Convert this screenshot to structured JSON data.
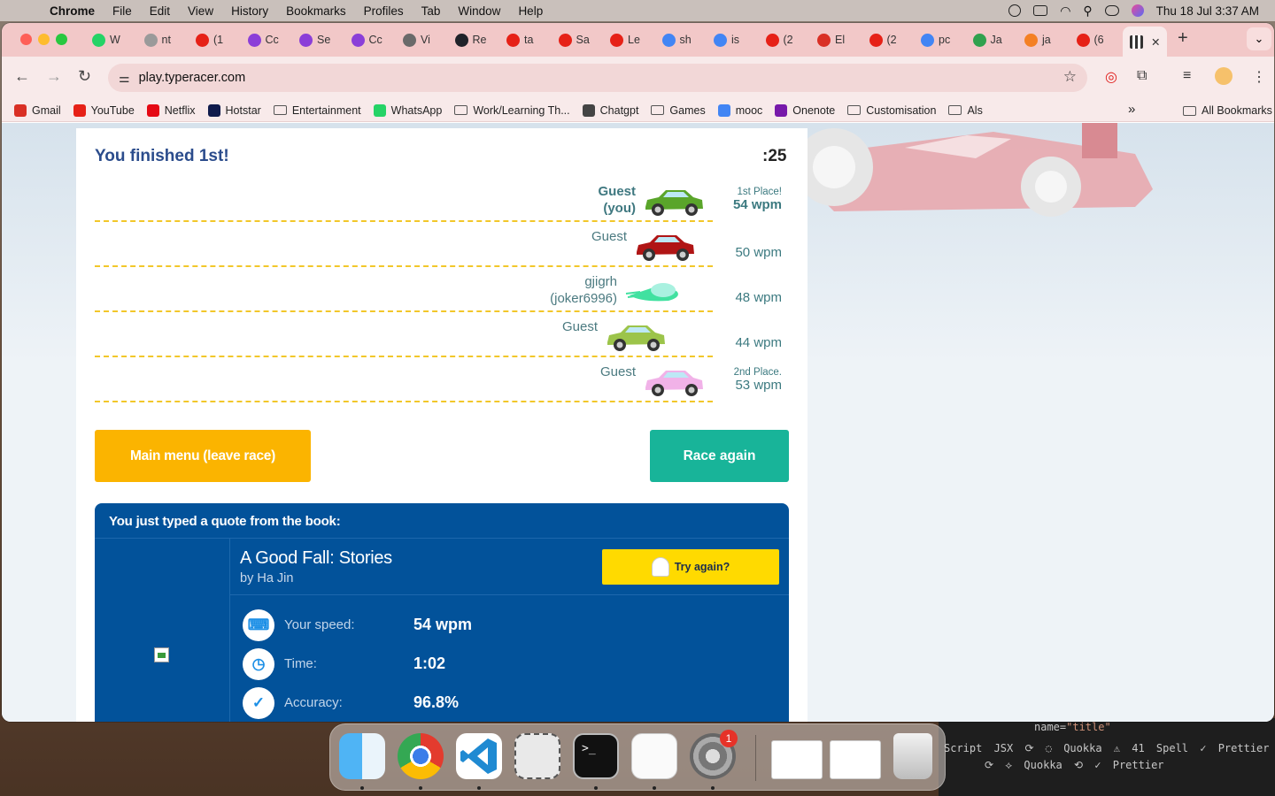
{
  "menubar": {
    "app": "Chrome",
    "items": [
      "File",
      "Edit",
      "View",
      "History",
      "Bookmarks",
      "Profiles",
      "Tab",
      "Window",
      "Help"
    ],
    "clock": "Thu 18 Jul  3:37 AM"
  },
  "tabs": [
    {
      "label": "W",
      "color": "#25d366"
    },
    {
      "label": "nt",
      "color": "#9a9a9a"
    },
    {
      "label": "(1",
      "color": "#e62117"
    },
    {
      "label": "Cc",
      "color": "#8b3fd8"
    },
    {
      "label": "Se",
      "color": "#8b3fd8"
    },
    {
      "label": "Cc",
      "color": "#8b3fd8"
    },
    {
      "label": "Vi",
      "color": "#6a6a6a"
    },
    {
      "label": "Re",
      "color": "#20232a"
    },
    {
      "label": "ta",
      "color": "#e62117"
    },
    {
      "label": "Sa",
      "color": "#e62117"
    },
    {
      "label": "Le",
      "color": "#e62117"
    },
    {
      "label": "sh",
      "color": "#4285f4"
    },
    {
      "label": "is",
      "color": "#4285f4"
    },
    {
      "label": "(2",
      "color": "#e62117"
    },
    {
      "label": "El",
      "color": "#d93025"
    },
    {
      "label": "(2",
      "color": "#e62117"
    },
    {
      "label": "pc",
      "color": "#4285f4"
    },
    {
      "label": "Ja",
      "color": "#30a14e"
    },
    {
      "label": "ja",
      "color": "#f48024"
    },
    {
      "label": "(6",
      "color": "#e62117"
    }
  ],
  "active_tab": {
    "close": "✕"
  },
  "address": {
    "url": "play.typeracer.com"
  },
  "bookmarks": [
    {
      "label": "Gmail",
      "type": "site",
      "color": "#d93025"
    },
    {
      "label": "YouTube",
      "type": "site",
      "color": "#e62117"
    },
    {
      "label": "Netflix",
      "type": "site",
      "color": "#e50914"
    },
    {
      "label": "Hotstar",
      "type": "site",
      "color": "#0f1b4c"
    },
    {
      "label": "Entertainment",
      "type": "folder"
    },
    {
      "label": "WhatsApp",
      "type": "site",
      "color": "#25d366"
    },
    {
      "label": "Work/Learning Th...",
      "type": "folder"
    },
    {
      "label": "Chatgpt",
      "type": "site",
      "color": "#444444"
    },
    {
      "label": "Games",
      "type": "folder"
    },
    {
      "label": "mooc",
      "type": "site",
      "color": "#4285f4"
    },
    {
      "label": "Onenote",
      "type": "site",
      "color": "#7719aa"
    },
    {
      "label": "Customisation",
      "type": "folder"
    },
    {
      "label": "Als",
      "type": "folder"
    }
  ],
  "bookmarks_more": "»",
  "all_bookmarks": "All Bookmarks",
  "race": {
    "heading": "You finished 1st!",
    "timer": ":25",
    "racers": [
      {
        "name_line1": "Guest",
        "name_line2": "(you)",
        "place": "1st Place!",
        "wpm": "54 wpm",
        "car_color": "#5aa52a",
        "you": true
      },
      {
        "name_line1": "Guest",
        "name_line2": "",
        "place": "",
        "wpm": "50 wpm",
        "car_color": "#b01515",
        "you": false
      },
      {
        "name_line1": "gjigrh",
        "name_line2": "(joker6996)",
        "place": "",
        "wpm": "48 wpm",
        "car_color": "#41e1a0",
        "you": false
      },
      {
        "name_line1": "Guest",
        "name_line2": "",
        "place": "",
        "wpm": "44 wpm",
        "car_color": "#9cc44a",
        "you": false
      },
      {
        "name_line1": "Guest",
        "name_line2": "",
        "place": "2nd Place.",
        "wpm": "53 wpm",
        "car_color": "#f1b2e8",
        "you": false
      }
    ],
    "main_menu_button": "Main menu (leave race)",
    "race_again_button": "Race again"
  },
  "quote": {
    "heading": "You just typed a quote from the book:",
    "book_title": "A Good Fall: Stories",
    "author": "by Ha Jin",
    "try_again": "Try again?",
    "stats": [
      {
        "label": "Your speed:",
        "value": "54 wpm",
        "icon": "keyboard-icon"
      },
      {
        "label": "Time:",
        "value": "1:02",
        "icon": "clock-icon"
      },
      {
        "label": "Accuracy:",
        "value": "96.8%",
        "icon": "check-icon"
      }
    ]
  },
  "dock": {
    "apps": [
      "Finder",
      "Google Chrome",
      "Visual Studio Code",
      "Screenshot",
      "Terminal",
      "System Information",
      "System Settings"
    ],
    "settings_badge": "1"
  },
  "editor_strip": {
    "line1_attr": "name=",
    "line1_value": "\"title\"",
    "line2": "Script JSX  ⟳  ◌ Quokka  ⚠ 41 Spell  ✓ Prettier",
    "line3": "⟳  ⟡ Quokka  ⟲  ✓ Prettier"
  }
}
